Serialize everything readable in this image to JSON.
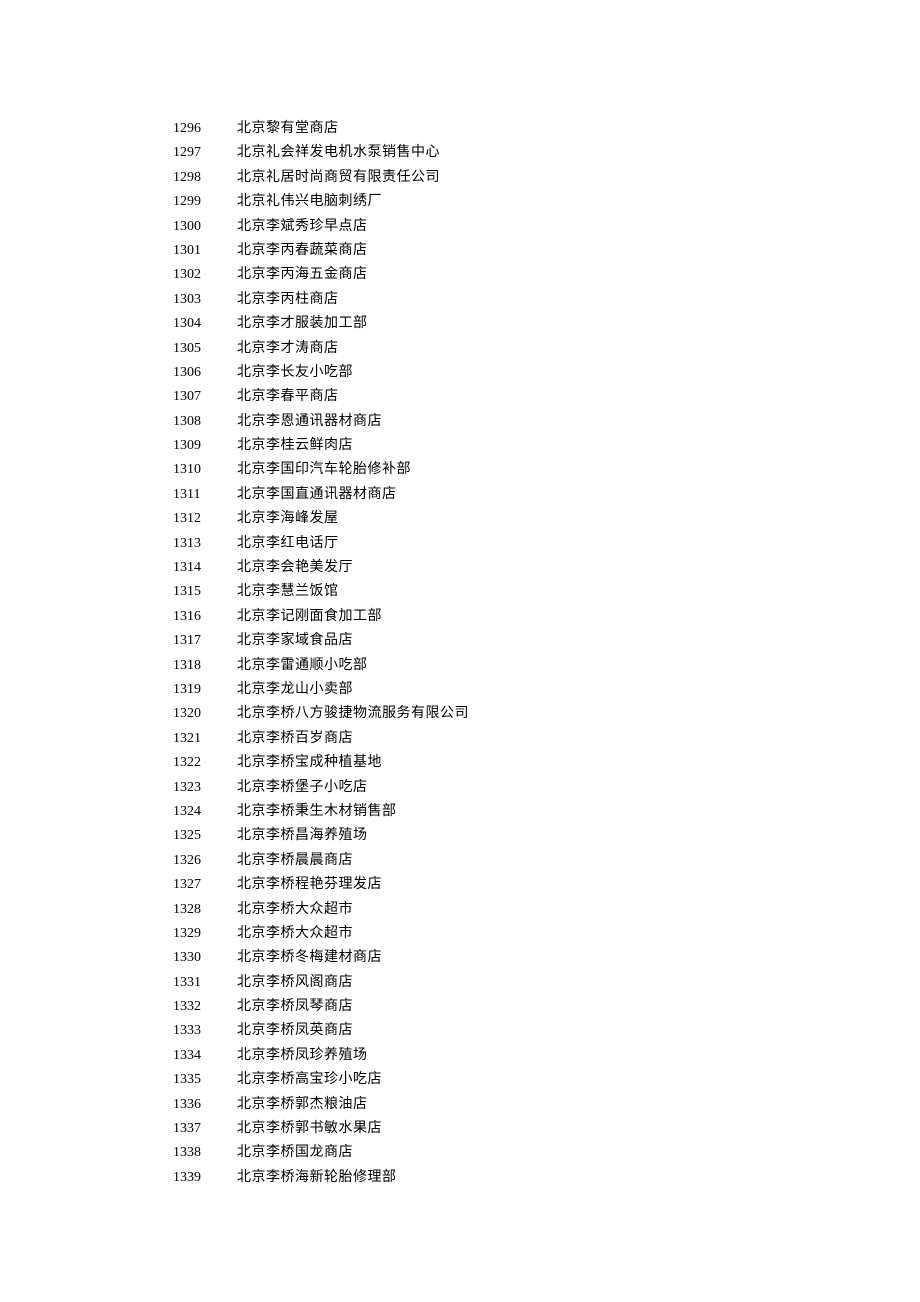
{
  "rows": [
    {
      "num": "1296",
      "name": "北京黎有堂商店"
    },
    {
      "num": "1297",
      "name": "北京礼会祥发电机水泵销售中心"
    },
    {
      "num": "1298",
      "name": "北京礼居时尚商贸有限责任公司"
    },
    {
      "num": "1299",
      "name": "北京礼伟兴电脑刺绣厂"
    },
    {
      "num": "1300",
      "name": "北京李斌秀珍早点店"
    },
    {
      "num": "1301",
      "name": "北京李丙春蔬菜商店"
    },
    {
      "num": "1302",
      "name": "北京李丙海五金商店"
    },
    {
      "num": "1303",
      "name": "北京李丙柱商店"
    },
    {
      "num": "1304",
      "name": "北京李才服装加工部"
    },
    {
      "num": "1305",
      "name": "北京李才涛商店"
    },
    {
      "num": "1306",
      "name": "北京李长友小吃部"
    },
    {
      "num": "1307",
      "name": "北京李春平商店"
    },
    {
      "num": "1308",
      "name": "北京李恩通讯器材商店"
    },
    {
      "num": "1309",
      "name": "北京李桂云鲜肉店"
    },
    {
      "num": "1310",
      "name": "北京李国印汽车轮胎修补部"
    },
    {
      "num": "1311",
      "name": "北京李国直通讯器材商店"
    },
    {
      "num": "1312",
      "name": "北京李海峰发屋"
    },
    {
      "num": "1313",
      "name": "北京李红电话厅"
    },
    {
      "num": "1314",
      "name": "北京李会艳美发厅"
    },
    {
      "num": "1315",
      "name": "北京李慧兰饭馆"
    },
    {
      "num": "1316",
      "name": "北京李记刚面食加工部"
    },
    {
      "num": "1317",
      "name": "北京李家域食品店"
    },
    {
      "num": "1318",
      "name": "北京李雷通顺小吃部"
    },
    {
      "num": "1319",
      "name": "北京李龙山小卖部"
    },
    {
      "num": "1320",
      "name": "北京李桥八方骏捷物流服务有限公司"
    },
    {
      "num": "1321",
      "name": "北京李桥百岁商店"
    },
    {
      "num": "1322",
      "name": "北京李桥宝成种植基地"
    },
    {
      "num": "1323",
      "name": "北京李桥堡子小吃店"
    },
    {
      "num": "1324",
      "name": "北京李桥秉生木材销售部"
    },
    {
      "num": "1325",
      "name": "北京李桥昌海养殖场"
    },
    {
      "num": "1326",
      "name": "北京李桥晨晨商店"
    },
    {
      "num": "1327",
      "name": "北京李桥程艳芬理发店"
    },
    {
      "num": "1328",
      "name": "北京李桥大众超市"
    },
    {
      "num": "1329",
      "name": "北京李桥大众超市"
    },
    {
      "num": "1330",
      "name": "北京李桥冬梅建材商店"
    },
    {
      "num": "1331",
      "name": "北京李桥风阁商店"
    },
    {
      "num": "1332",
      "name": "北京李桥凤琴商店"
    },
    {
      "num": "1333",
      "name": "北京李桥凤英商店"
    },
    {
      "num": "1334",
      "name": "北京李桥凤珍养殖场"
    },
    {
      "num": "1335",
      "name": "北京李桥高宝珍小吃店"
    },
    {
      "num": "1336",
      "name": "北京李桥郭杰粮油店"
    },
    {
      "num": "1337",
      "name": "北京李桥郭书敏水果店"
    },
    {
      "num": "1338",
      "name": "北京李桥国龙商店"
    },
    {
      "num": "1339",
      "name": "北京李桥海新轮胎修理部"
    }
  ]
}
